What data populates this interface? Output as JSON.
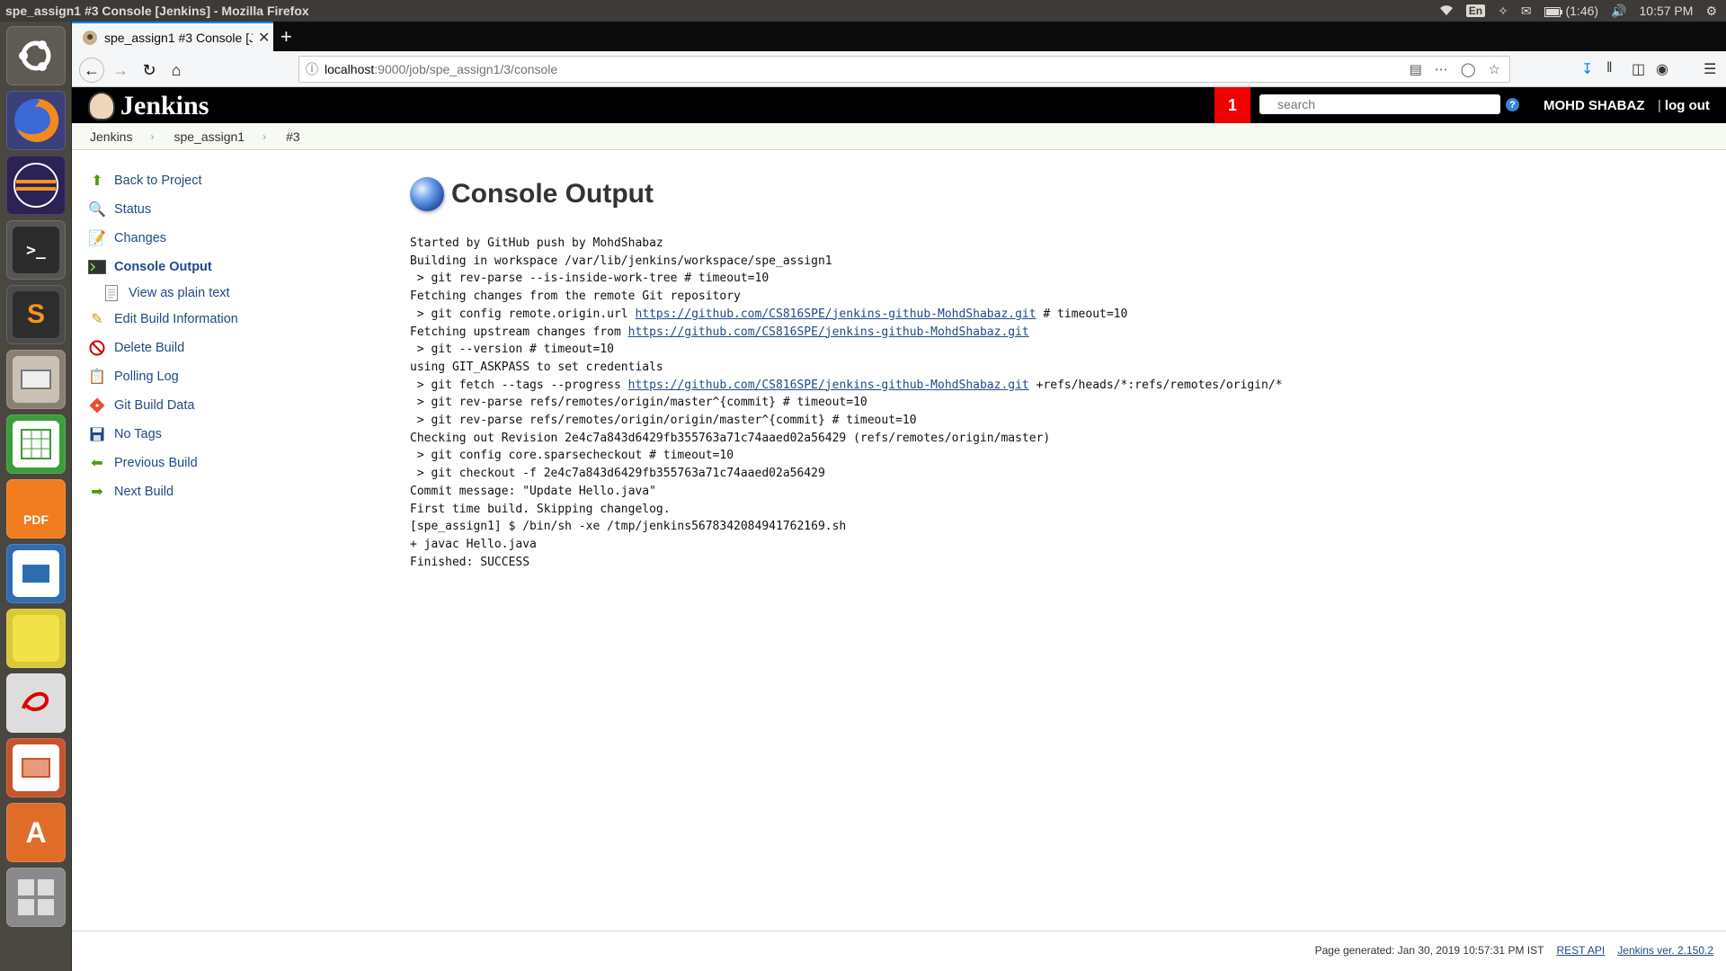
{
  "os": {
    "window_title": "spe_assign1 #3 Console [Jenkins] - Mozilla Firefox",
    "indicators": {
      "keyboard": "En",
      "battery": "(1:46)",
      "time": "10:57 PM"
    }
  },
  "launcher": [
    {
      "name": "ubuntu-dash-icon",
      "color": "#6f6a63"
    },
    {
      "name": "firefox-icon",
      "color": "#e66000"
    },
    {
      "name": "eclipse-icon",
      "color": "#2c2255"
    },
    {
      "name": "terminal-icon",
      "color": "#2b2b2b"
    },
    {
      "name": "sublime-text-icon",
      "color": "#4b4b4b"
    },
    {
      "name": "file-manager-icon",
      "color": "#8a7f73"
    },
    {
      "name": "spreadsheet-icon",
      "color": "#3a9e3a"
    },
    {
      "name": "pdf-editor-icon",
      "color": "#f07c1f",
      "label": "PDF"
    },
    {
      "name": "writer-icon",
      "color": "#2f6db3"
    },
    {
      "name": "sticky-notes-icon",
      "color": "#f2e24a"
    },
    {
      "name": "evince-icon",
      "color": "#e8e8e8"
    },
    {
      "name": "impress-icon",
      "color": "#c8542b"
    },
    {
      "name": "software-center-icon",
      "color": "#e06c2a"
    },
    {
      "name": "workspace-switcher-icon",
      "color": "#8a8a8a"
    }
  ],
  "browser": {
    "tab_title": "spe_assign1 #3 Console [Jenkins]",
    "url_host": "localhost",
    "url_path": ":9000/job/spe_assign1/3/console"
  },
  "jenkins": {
    "logo_text": "Jenkins",
    "notification_count": "1",
    "search_placeholder": "search",
    "help_label": "?",
    "user": "MOHD SHABAZ",
    "logout": "log out",
    "breadcrumbs": [
      "Jenkins",
      "spe_assign1",
      "#3"
    ],
    "tasks": [
      {
        "label": "Back to Project",
        "icon": "up-arrow-icon",
        "color": "#4e9a06"
      },
      {
        "label": "Status",
        "icon": "magnifier-icon",
        "color": "#3465a4"
      },
      {
        "label": "Changes",
        "icon": "notepad-icon",
        "color": "#c4a000"
      },
      {
        "label": "Console Output",
        "icon": "terminal-icon",
        "color": "#2e3436"
      },
      {
        "label": "View as plain text",
        "icon": "document-icon",
        "color": "#888a85"
      },
      {
        "label": "Edit Build Information",
        "icon": "notepad-pencil-icon",
        "color": "#c4a000"
      },
      {
        "label": "Delete Build",
        "icon": "no-entry-icon",
        "color": "#cc0000"
      },
      {
        "label": "Polling Log",
        "icon": "clipboard-icon",
        "color": "#8f5902"
      },
      {
        "label": "Git Build Data",
        "icon": "git-icon",
        "color": "#e84e31"
      },
      {
        "label": "No Tags",
        "icon": "save-disk-icon",
        "color": "#204a87"
      },
      {
        "label": "Previous Build",
        "icon": "left-arrow-icon",
        "color": "#4e9a06"
      },
      {
        "label": "Next Build",
        "icon": "right-arrow-icon",
        "color": "#4e9a06"
      }
    ],
    "page_title": "Console Output",
    "console": {
      "l1": "Started by GitHub push by MohdShabaz",
      "l2": "Building in workspace /var/lib/jenkins/workspace/spe_assign1",
      "l3": " > git rev-parse --is-inside-work-tree # timeout=10",
      "l4": "Fetching changes from the remote Git repository",
      "l5a": " > git config remote.origin.url ",
      "repo_url": "https://github.com/CS816SPE/jenkins-github-MohdShabaz.git",
      "l5b": " # timeout=10",
      "l6a": "Fetching upstream changes from ",
      "l7": " > git --version # timeout=10",
      "l8": "using GIT_ASKPASS to set credentials",
      "l9a": " > git fetch --tags --progress ",
      "l9b": " +refs/heads/*:refs/remotes/origin/*",
      "l10": " > git rev-parse refs/remotes/origin/master^{commit} # timeout=10",
      "l11": " > git rev-parse refs/remotes/origin/origin/master^{commit} # timeout=10",
      "l12": "Checking out Revision 2e4c7a843d6429fb355763a71c74aaed02a56429 (refs/remotes/origin/master)",
      "l13": " > git config core.sparsecheckout # timeout=10",
      "l14": " > git checkout -f 2e4c7a843d6429fb355763a71c74aaed02a56429",
      "l15": "Commit message: \"Update Hello.java\"",
      "l16": "First time build. Skipping changelog.",
      "l17": "[spe_assign1] $ /bin/sh -xe /tmp/jenkins5678342084941762169.sh",
      "l18": "+ javac Hello.java",
      "l19": "Finished: SUCCESS"
    },
    "footer": {
      "generated": "Page generated: Jan 30, 2019 10:57:31 PM IST",
      "rest_api": "REST API",
      "version": "Jenkins ver. 2.150.2"
    }
  }
}
